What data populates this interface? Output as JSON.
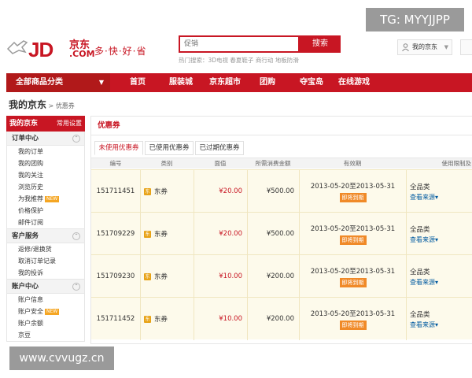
{
  "watermarks": {
    "tg": "TG: MYYJJPP",
    "url": "www.cvvugz.cn"
  },
  "header": {
    "logo_jd": "JD",
    "logo_cn": "京东",
    "logo_com": ".COM",
    "slogan": "多·快·好·省",
    "search": {
      "placeholder": "促销",
      "button": "搜索"
    },
    "hot_searches": "热门搜索：3D电视  春夏鞋子  商行动  地板防滑",
    "my_jd": "我的京东"
  },
  "nav": {
    "category": "全部商品分类",
    "items": [
      "首页",
      "服装城",
      "京东超市",
      "团购",
      "夺宝岛",
      "在线游戏"
    ]
  },
  "breadcrumb": {
    "title": "我的京东",
    "sep": " > ",
    "sub": "优惠券"
  },
  "sidebar": {
    "head": "我的京东",
    "settings": "常用设置",
    "sections": [
      {
        "title": "订单中心",
        "items": [
          "我的订单",
          "我的团购",
          "我的关注",
          "浏览历史",
          "为我推荐",
          "价格保护",
          "邮件订阅"
        ]
      },
      {
        "title": "客户服务",
        "items": [
          "返修/退换货",
          "取消订单记录",
          "我的投诉"
        ]
      },
      {
        "title": "账户中心",
        "items": [
          "账户信息",
          "账户安全",
          "账户余额",
          "京豆"
        ]
      }
    ],
    "badge": "NEW"
  },
  "main": {
    "title": "优惠券",
    "tabs": [
      "未使用优惠券",
      "已使用优惠券",
      "已过期优惠券"
    ],
    "columns": [
      "编号",
      "类别",
      "面值",
      "所需消费金额",
      "有效期",
      "使用限制及"
    ],
    "rows": [
      {
        "id": "151711451",
        "type_icon": "东",
        "type": "东券",
        "value": "¥20.00",
        "min": "¥500.00",
        "valid": "2013-05-20至2013-05-31",
        "tag": "即将到期",
        "limit": "全品类",
        "source": "查看来源"
      },
      {
        "id": "151709229",
        "type_icon": "东",
        "type": "东券",
        "value": "¥20.00",
        "min": "¥500.00",
        "valid": "2013-05-20至2013-05-31",
        "tag": "即将到期",
        "limit": "全品类",
        "source": "查看来源"
      },
      {
        "id": "151709230",
        "type_icon": "东",
        "type": "东券",
        "value": "¥10.00",
        "min": "¥200.00",
        "valid": "2013-05-20至2013-05-31",
        "tag": "即将到期",
        "limit": "全品类",
        "source": "查看来源"
      },
      {
        "id": "151711452",
        "type_icon": "东",
        "type": "东券",
        "value": "¥10.00",
        "min": "¥200.00",
        "valid": "2013-05-20至2013-05-31",
        "tag": "即将到期",
        "limit": "全品类",
        "source": "查看来源"
      }
    ]
  },
  "colors": {
    "brand_red": "#c81623",
    "link_blue": "#005aa0",
    "row_bg": "#fdfaeb",
    "tag_orange": "#f08a28"
  }
}
